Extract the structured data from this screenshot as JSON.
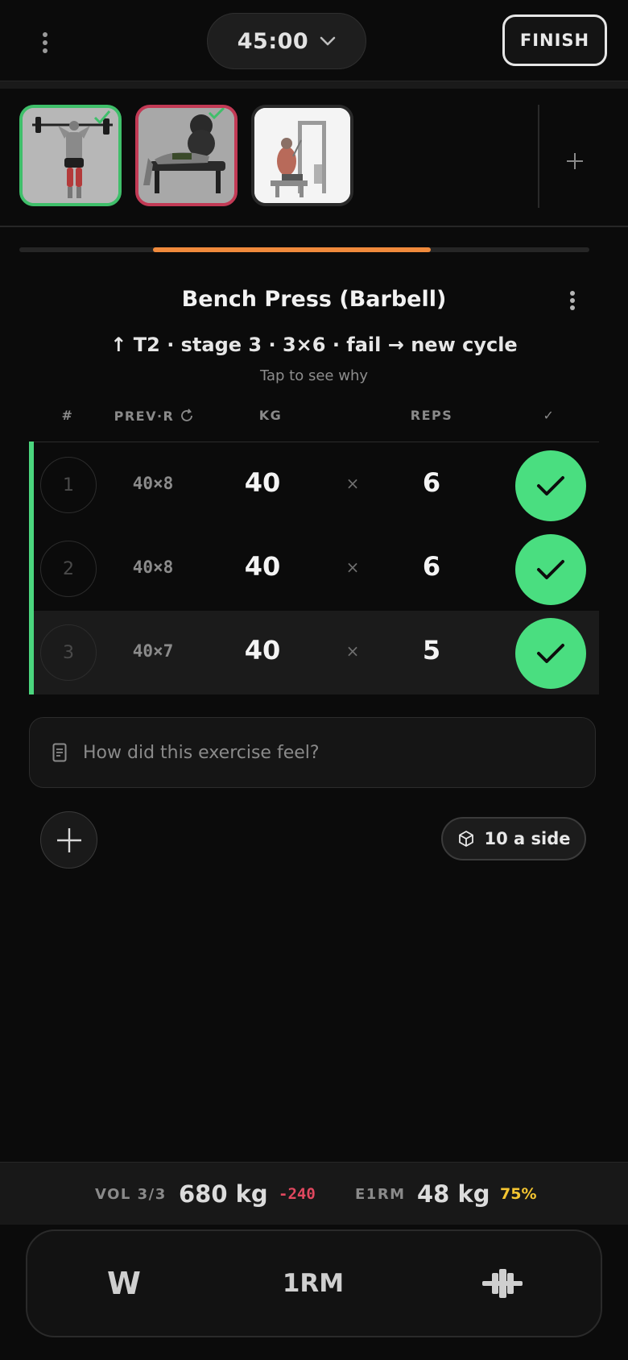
{
  "header": {
    "timer": "45:00",
    "finish_label": "FINISH"
  },
  "thumbnails": [
    {
      "name": "overhead-press",
      "status": "done",
      "border_color": "#3fbf6a"
    },
    {
      "name": "bench-press",
      "status": "current",
      "border_color": "#c23a55"
    },
    {
      "name": "seated-cable-row",
      "status": "pending"
    }
  ],
  "progress": {
    "fraction_start": 0.235,
    "fraction_end": 0.722,
    "color": "#f08a3c"
  },
  "exercise": {
    "title": "Bench Press (Barbell)",
    "progression": "↑ T2 · stage 3 · 3×6 · fail → new cycle",
    "why": "Tap to see why"
  },
  "table": {
    "headers": {
      "num": "#",
      "prev": "PREV·R",
      "kg": "KG",
      "reps": "REPS",
      "check": "✓"
    },
    "sets": [
      {
        "num": "1",
        "prev": "40×8",
        "kg": "40",
        "times": "×",
        "reps": "6",
        "done": true
      },
      {
        "num": "2",
        "prev": "40×8",
        "kg": "40",
        "times": "×",
        "reps": "6",
        "done": true
      },
      {
        "num": "3",
        "prev": "40×7",
        "kg": "40",
        "times": "×",
        "reps": "5",
        "done": true
      }
    ]
  },
  "note": {
    "placeholder": "How did this exercise feel?"
  },
  "plates": {
    "label": "10 a side"
  },
  "stats": {
    "vol_label": "VOL 3/3",
    "vol_value": "680 kg",
    "vol_delta": "-240",
    "e1rm_label": "E1RM",
    "e1rm_value": "48 kg",
    "e1rm_pct": "75%"
  },
  "bottom_bar": {
    "warmup_label": "W",
    "onerm_label": "1RM",
    "plates_icon": "barbell-plates-icon"
  },
  "colors": {
    "accent_green": "#4ade80",
    "accent_orange": "#f08a3c",
    "negative": "#e0485f",
    "warning": "#f4c531"
  }
}
